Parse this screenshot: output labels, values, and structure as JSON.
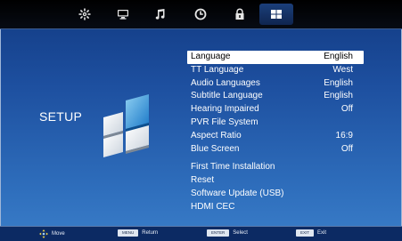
{
  "tabs": [
    {
      "icon": "settings-gear-icon"
    },
    {
      "icon": "picture-monitor-icon"
    },
    {
      "icon": "music-note-icon"
    },
    {
      "icon": "clock-timer-icon"
    },
    {
      "icon": "lock-icon"
    },
    {
      "icon": "setup-grid-icon",
      "active": true
    }
  ],
  "page_title": "SETUP",
  "menu": [
    {
      "label": "Language",
      "value": "English",
      "selected": true
    },
    {
      "label": "TT Language",
      "value": "West"
    },
    {
      "label": "Audio Languages",
      "value": "English"
    },
    {
      "label": "Subtitle Language",
      "value": "English"
    },
    {
      "label": "Hearing Impaired",
      "value": "Off"
    },
    {
      "label": "PVR File System",
      "value": ""
    },
    {
      "label": "Aspect Ratio",
      "value": "16:9"
    },
    {
      "label": "Blue Screen",
      "value": "Off"
    },
    {
      "label": "First Time Installation",
      "value": ""
    },
    {
      "label": "Reset",
      "value": ""
    },
    {
      "label": "Software Update (USB)",
      "value": ""
    },
    {
      "label": "HDMI CEC",
      "value": ""
    }
  ],
  "footer": {
    "move": {
      "key": "",
      "label": "Move"
    },
    "return": {
      "key": "MENU",
      "label": "Return"
    },
    "select": {
      "key": "ENTER",
      "label": "Select"
    },
    "exit": {
      "key": "EXIT",
      "label": "Exit"
    }
  }
}
